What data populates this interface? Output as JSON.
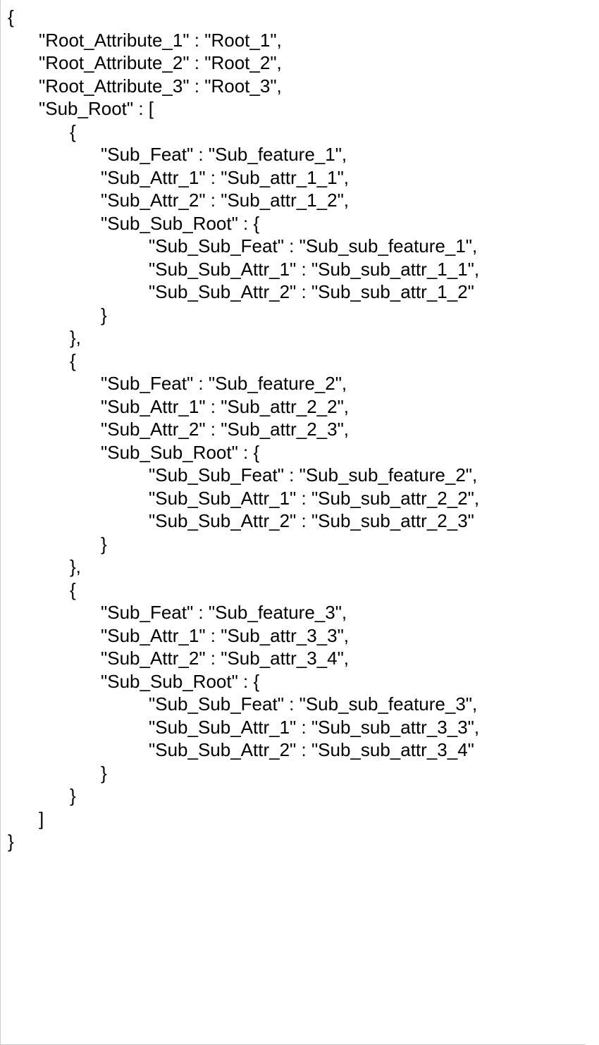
{
  "lines": {
    "l0": "{",
    "l1": "\"Root_Attribute_1\" : \"Root_1\",",
    "l2": "\"Root_Attribute_2\" : \"Root_2\",",
    "l3": "\"Root_Attribute_3\" : \"Root_3\",",
    "l4": "\"Sub_Root\" : [",
    "l5": "{",
    "l6": "\"Sub_Feat\" : \"Sub_feature_1\",",
    "l7": "\"Sub_Attr_1\" : \"Sub_attr_1_1\",",
    "l8": "\"Sub_Attr_2\" : \"Sub_attr_1_2\",",
    "l9": "\"Sub_Sub_Root\" : {",
    "l10": "\"Sub_Sub_Feat\" : \"Sub_sub_feature_1\",",
    "l11": "\"Sub_Sub_Attr_1\" : \"Sub_sub_attr_1_1\",",
    "l12": "\"Sub_Sub_Attr_2\" : \"Sub_sub_attr_1_2\"",
    "l13": "}",
    "l14": "},",
    "l15": "{",
    "l16": "\"Sub_Feat\" : \"Sub_feature_2\",",
    "l17": "\"Sub_Attr_1\" : \"Sub_attr_2_2\",",
    "l18": "\"Sub_Attr_2\" : \"Sub_attr_2_3\",",
    "l19": "\"Sub_Sub_Root\" : {",
    "l20": "\"Sub_Sub_Feat\" : \"Sub_sub_feature_2\",",
    "l21": "\"Sub_Sub_Attr_1\" : \"Sub_sub_attr_2_2\",",
    "l22": "\"Sub_Sub_Attr_2\" : \"Sub_sub_attr_2_3\"",
    "l23": "}",
    "l24": "},",
    "l25": "{",
    "l26": "\"Sub_Feat\" : \"Sub_feature_3\",",
    "l27": "\"Sub_Attr_1\" : \"Sub_attr_3_3\",",
    "l28": "\"Sub_Attr_2\" : \"Sub_attr_3_4\",",
    "l29": "\"Sub_Sub_Root\" : {",
    "l30": "\"Sub_Sub_Feat\" : \"Sub_sub_feature_3\",",
    "l31": "\"Sub_Sub_Attr_1\" : \"Sub_sub_attr_3_3\",",
    "l32": "\"Sub_Sub_Attr_2\" : \"Sub_sub_attr_3_4\"",
    "l33": "}",
    "l34": "}",
    "l35": "]",
    "l36": "}"
  }
}
